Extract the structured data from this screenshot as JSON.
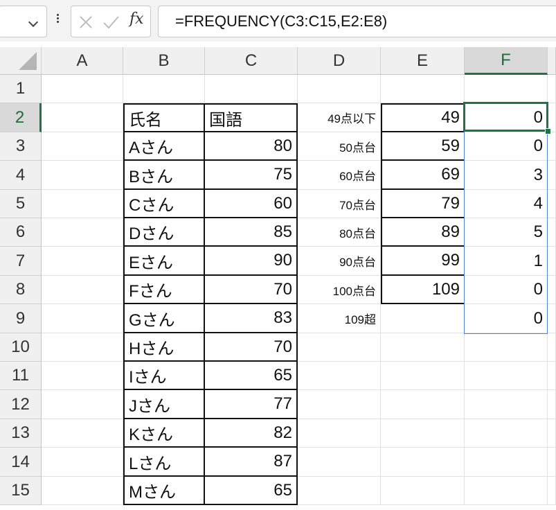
{
  "formula_bar": {
    "formula": "=FREQUENCY(C3:C15,E2:E8)",
    "fx_label": "fx"
  },
  "columns": [
    "A",
    "B",
    "C",
    "D",
    "E",
    "F"
  ],
  "rows": [
    "1",
    "2",
    "3",
    "4",
    "5",
    "6",
    "7",
    "8",
    "9",
    "10",
    "11",
    "12",
    "13",
    "14",
    "15"
  ],
  "score_table": {
    "header_name": "氏名",
    "header_subject": "国語",
    "names": [
      "Aさん",
      "Bさん",
      "Cさん",
      "Dさん",
      "Eさん",
      "Fさん",
      "Gさん",
      "Hさん",
      "Iさん",
      "Jさん",
      "Kさん",
      "Lさん",
      "Mさん"
    ],
    "scores": [
      "80",
      "75",
      "60",
      "85",
      "90",
      "70",
      "83",
      "70",
      "65",
      "77",
      "82",
      "87",
      "65"
    ]
  },
  "bins_table": {
    "labels": [
      "49点以下",
      "50点台",
      "60点台",
      "70点台",
      "80点台",
      "90点台",
      "100点台",
      "109超"
    ],
    "bins": [
      "49",
      "59",
      "69",
      "79",
      "89",
      "99",
      "109"
    ],
    "frequencies": [
      "0",
      "0",
      "3",
      "4",
      "5",
      "1",
      "0",
      "0"
    ]
  },
  "selection": {
    "active_cell": "F2",
    "range": "F2:F9"
  },
  "colors": {
    "accent_green": "#217346",
    "range_blue": "#4a86d8"
  }
}
